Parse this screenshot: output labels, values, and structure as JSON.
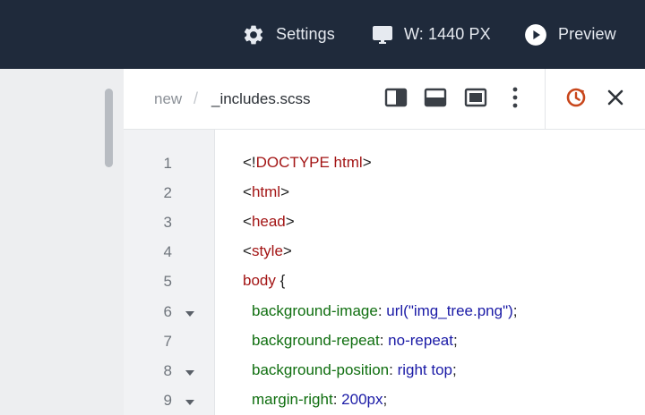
{
  "topbar": {
    "settings_label": "Settings",
    "width_label": "W: 1440 PX",
    "preview_label": "Preview"
  },
  "tabbar": {
    "breadcrumb_root": "new",
    "breadcrumb_sep": "/",
    "file_name": "_includes.scss",
    "icons": [
      "layout-right-panel-icon",
      "layout-bottom-panel-icon",
      "layout-full-icon",
      "more-vertical-icon",
      "history-icon",
      "close-icon"
    ]
  },
  "colors": {
    "topbar_bg": "#1f2a3b",
    "history_accent": "#c8461b",
    "tag": "#a31515",
    "property": "#0f6e0f",
    "value": "#1a1aa6"
  },
  "editor": {
    "line_numbers": [
      "1",
      "2",
      "3",
      "4",
      "5",
      "6",
      "7",
      "8",
      "9"
    ],
    "folds": [
      false,
      false,
      false,
      false,
      false,
      true,
      false,
      true,
      true
    ],
    "lines": [
      {
        "parts": [
          "<!",
          "DOCTYPE html",
          ">"
        ]
      },
      {
        "parts": [
          "<",
          "html",
          ">"
        ]
      },
      {
        "parts": [
          "<",
          "head",
          ">"
        ]
      },
      {
        "parts": [
          "<",
          "style",
          ">"
        ]
      },
      {
        "parts": [
          "body",
          " {"
        ]
      },
      {
        "parts": [
          "background-image",
          ": ",
          "url(\"img_tree.png\")",
          ";"
        ]
      },
      {
        "parts": [
          "background-repeat",
          ": ",
          "no-repeat",
          ";"
        ]
      },
      {
        "parts": [
          "background-position",
          ": ",
          "right top",
          ";"
        ]
      },
      {
        "parts": [
          "margin-right",
          ": ",
          "200px",
          ";"
        ]
      }
    ]
  }
}
